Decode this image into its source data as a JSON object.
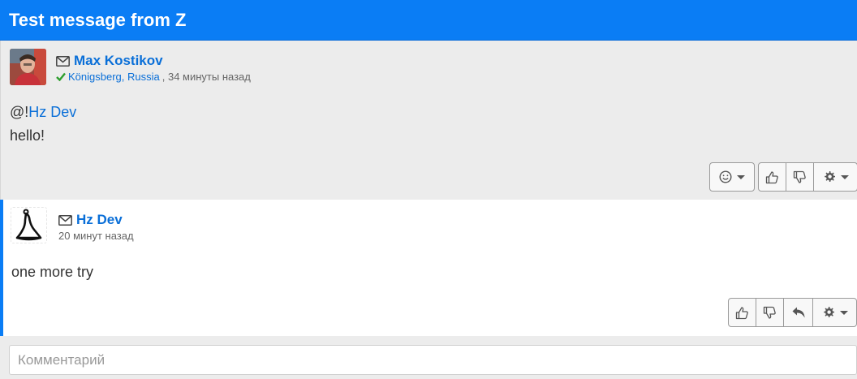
{
  "header": {
    "title": "Test message from Z"
  },
  "post": {
    "author": "Max Kostikov",
    "location": "Königsberg, Russia",
    "time": ", 34 минуты назад",
    "mention_prefix": "@!",
    "mention_name": "Hz Dev",
    "text": "hello!",
    "actions": {
      "emoji_icon": "smile-icon",
      "like_icon": "thumbs-up-icon",
      "dislike_icon": "thumbs-down-icon",
      "settings_icon": "gear-icon"
    }
  },
  "reply": {
    "author": "Hz Dev",
    "time": "20 минут назад",
    "text": "one more try",
    "actions": {
      "like_icon": "thumbs-up-icon",
      "dislike_icon": "thumbs-down-icon",
      "reply_icon": "reply-icon",
      "settings_icon": "gear-icon"
    }
  },
  "comment": {
    "placeholder": "Комментарий"
  },
  "colors": {
    "accent": "#0a7df5",
    "link": "#0a6fd8",
    "check": "#2e9e2e",
    "post_bg": "#ececec"
  }
}
